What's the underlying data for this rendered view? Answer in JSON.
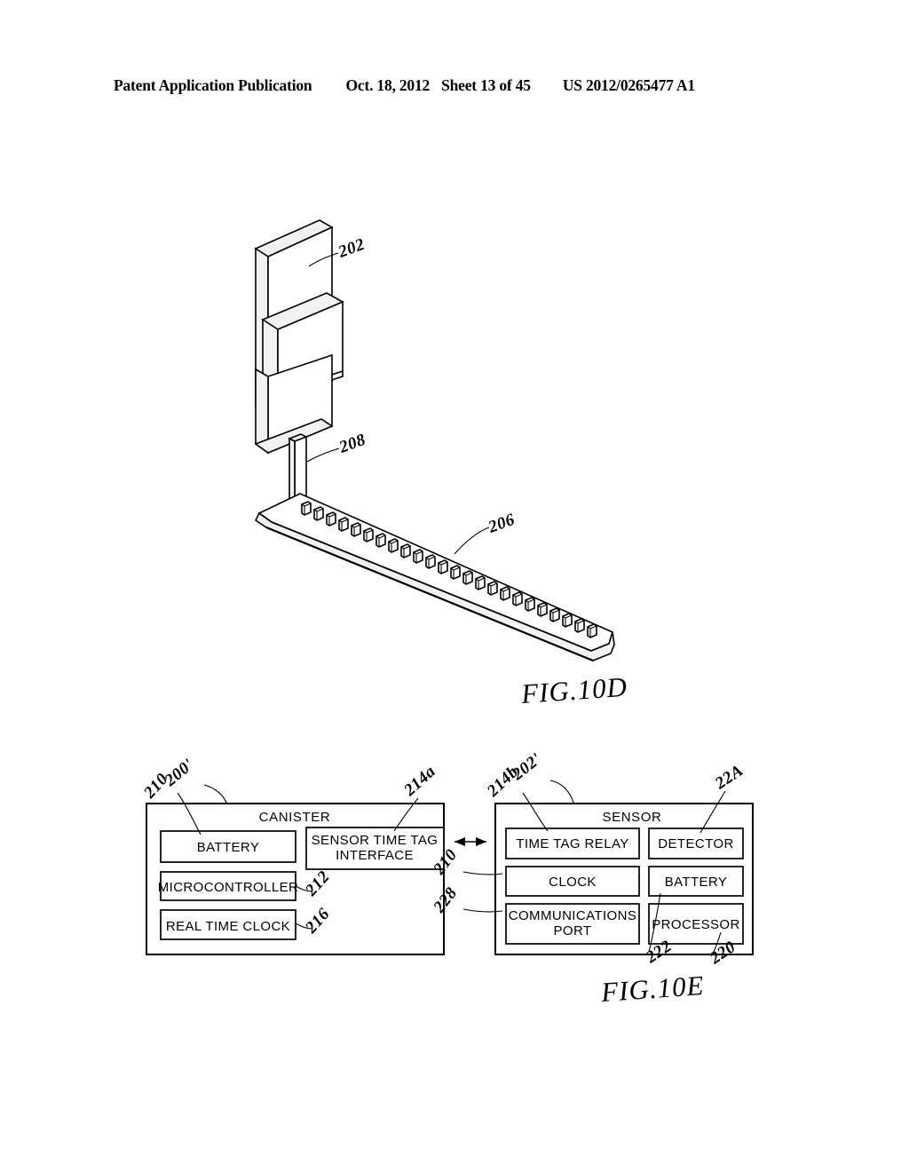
{
  "header": {
    "publication": "Patent Application Publication",
    "date": "Oct. 18, 2012",
    "sheet": "Sheet 13 of 45",
    "number": "US 2012/0265477 A1"
  },
  "figures": [
    {
      "id": "fig-10d",
      "caption": "FIG.10D",
      "type": "isometric-assembly",
      "description": "Exploded isometric view of a stacked plate assembly, a thin vertical post, and an elongated base plate carrying a row of connector clips.",
      "reference_numerals": [
        {
          "label": "202",
          "points_to": "stacked-plate-assembly"
        },
        {
          "label": "208",
          "points_to": "vertical-post"
        },
        {
          "label": "206",
          "points_to": "base-plate"
        }
      ],
      "base_plate_pin_count": 24
    },
    {
      "id": "fig-10e",
      "caption": "FIG.10E",
      "type": "block-diagram",
      "reference_numerals": [
        {
          "label": "200'",
          "points_to": "canister-box"
        },
        {
          "label": "210",
          "points_to": "canister-battery"
        },
        {
          "label": "214a",
          "points_to": "sensor-time-tag-interface"
        },
        {
          "label": "212",
          "points_to": "microcontroller"
        },
        {
          "label": "216",
          "points_to": "real-time-clock"
        },
        {
          "label": "202'",
          "points_to": "sensor-box"
        },
        {
          "label": "214b",
          "points_to": "time-tag-relay"
        },
        {
          "label": "22A",
          "points_to": "detector"
        },
        {
          "label": "210",
          "points_to": "sensor-clock"
        },
        {
          "label": "228",
          "points_to": "communications-port"
        },
        {
          "label": "222",
          "points_to": "sensor-battery"
        },
        {
          "label": "220",
          "points_to": "processor"
        }
      ],
      "blocks": [
        {
          "id": "canister",
          "title": "CANISTER",
          "children": [
            {
              "id": "canister-battery",
              "label": "BATTERY"
            },
            {
              "id": "sensor-time-tag-interface",
              "label": "SENSOR TIME TAG INTERFACE",
              "line1": "SENSOR TIME TAG",
              "line2": "INTERFACE"
            },
            {
              "id": "microcontroller",
              "label": "MICROCONTROLLER"
            },
            {
              "id": "real-time-clock",
              "label": "REAL TIME CLOCK"
            }
          ]
        },
        {
          "id": "sensor",
          "title": "SENSOR",
          "children": [
            {
              "id": "time-tag-relay",
              "label": "TIME TAG RELAY"
            },
            {
              "id": "detector",
              "label": "DETECTOR"
            },
            {
              "id": "sensor-clock",
              "label": "CLOCK"
            },
            {
              "id": "sensor-battery",
              "label": "BATTERY"
            },
            {
              "id": "communications-port",
              "label": "COMMUNICATIONS PORT",
              "line1": "COMMUNICATIONS",
              "line2": "PORT"
            },
            {
              "id": "processor",
              "label": "PROCESSOR"
            }
          ]
        }
      ],
      "connector": {
        "id": "canister-sensor-link",
        "style": "double-headed-arrow"
      }
    }
  ],
  "colors": {
    "ink": "#000000",
    "paper": "#ffffff",
    "shade": "#f2f2f2"
  }
}
